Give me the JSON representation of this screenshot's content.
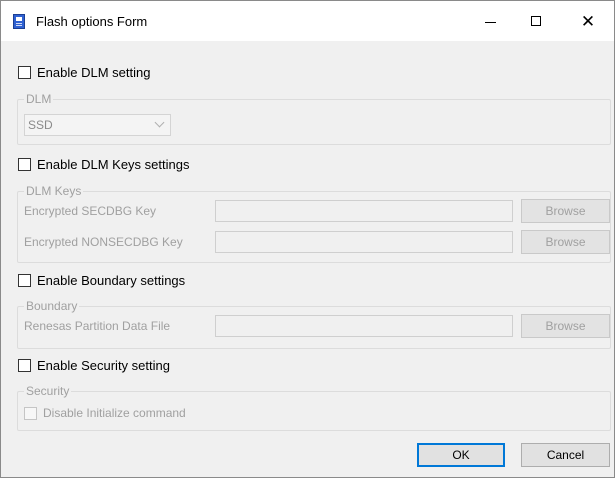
{
  "window": {
    "title": "Flash options Form",
    "controls": {
      "minimize": "minimize-icon",
      "maximize": "maximize-icon",
      "close": "close-icon"
    },
    "close_glyph": "✕"
  },
  "dlm": {
    "checkbox_label": "Enable DLM setting",
    "checked": false,
    "group_title": "DLM",
    "select_value": "SSD"
  },
  "dlm_keys": {
    "checkbox_label": "Enable DLM Keys settings",
    "checked": false,
    "group_title": "DLM Keys",
    "rows": [
      {
        "label": "Encrypted SECDBG Key",
        "value": "",
        "button": "Browse"
      },
      {
        "label": "Encrypted NONSECDBG Key",
        "value": "",
        "button": "Browse"
      }
    ]
  },
  "boundary": {
    "checkbox_label": "Enable Boundary settings",
    "checked": false,
    "group_title": "Boundary",
    "rows": [
      {
        "label": "Renesas Partition Data File",
        "value": "",
        "button": "Browse"
      }
    ]
  },
  "security": {
    "checkbox_label": "Enable Security setting",
    "checked": false,
    "group_title": "Security",
    "option_label": "Disable Initialize command",
    "option_checked": false
  },
  "buttons": {
    "ok": "OK",
    "cancel": "Cancel"
  },
  "colors": {
    "window_bg": "#f0f0f0",
    "disabled_text": "#a0a0a0",
    "focus_border": "#0078d7"
  }
}
